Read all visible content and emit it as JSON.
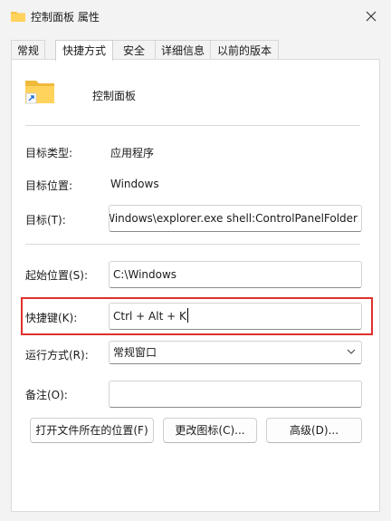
{
  "window": {
    "title": "控制面板 属性",
    "icon": "folder-icon",
    "close_icon": "close-icon"
  },
  "tabs": [
    {
      "label": "常规",
      "active": false
    },
    {
      "label": "快捷方式",
      "active": true
    },
    {
      "label": "安全",
      "active": false
    },
    {
      "label": "详细信息",
      "active": false
    },
    {
      "label": "以前的版本",
      "active": false
    }
  ],
  "shortcut": {
    "name": "控制面板",
    "target_type_label": "目标类型:",
    "target_type_value": "应用程序",
    "target_location_label": "目标位置:",
    "target_location_value": "Windows",
    "target_label": "目标(T):",
    "target_value": "C:\\Windows\\explorer.exe shell:ControlPanelFolder",
    "start_in_label": "起始位置(S):",
    "start_in_value": "C:\\Windows",
    "hotkey_label": "快捷键(K):",
    "hotkey_value": "Ctrl + Alt + K",
    "run_label": "运行方式(R):",
    "run_value": "常规窗口",
    "comment_label": "备注(O):",
    "comment_value": ""
  },
  "buttons": {
    "open_location": "打开文件所在的位置(F)",
    "change_icon": "更改图标(C)...",
    "advanced": "高级(D)..."
  },
  "colors": {
    "highlight": "#e0312d",
    "folder": "#f6c343"
  }
}
